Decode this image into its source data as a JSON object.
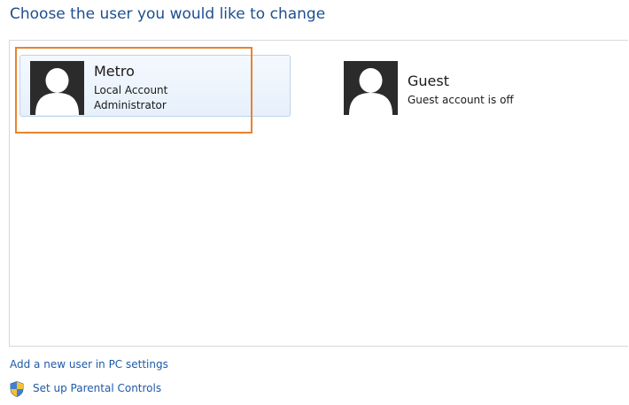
{
  "page": {
    "title": "Choose the user you would like to change"
  },
  "accounts": [
    {
      "name": "Metro",
      "lines": [
        "Local Account",
        "Administrator"
      ],
      "selected": true,
      "icon": "user-avatar-icon"
    },
    {
      "name": "Guest",
      "lines": [
        "Guest account is off"
      ],
      "selected": false,
      "icon": "user-avatar-icon"
    }
  ],
  "links": {
    "add_user": "Add a new user in PC settings",
    "parental_controls": "Set up Parental Controls",
    "parental_icon": "uac-shield-icon"
  },
  "colors": {
    "title": "#1e4f8f",
    "link": "#1d5aa8",
    "highlight": "#e8832e",
    "avatar_bg": "#2b2b2b"
  }
}
